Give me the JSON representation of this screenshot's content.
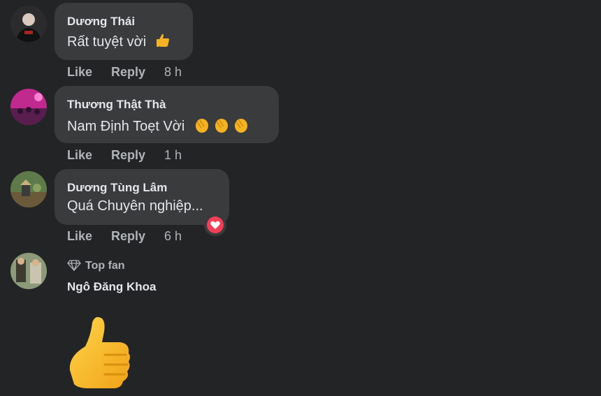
{
  "comments": [
    {
      "author": "Dương Thái",
      "text": "Rất tuyệt vời",
      "emoji": "thumbs-up",
      "like": "Like",
      "reply": "Reply",
      "time": "8 h"
    },
    {
      "author": "Thương Thật Thà",
      "text": "Nam Định Toẹt Vời",
      "emoji": "clapping-hands",
      "like": "Like",
      "reply": "Reply",
      "time": "1 h"
    },
    {
      "author": "Dương Tùng Lâm",
      "text": "Quá Chuyên nghiệp...",
      "reaction": "love",
      "like": "Like",
      "reply": "Reply",
      "time": "6 h"
    },
    {
      "badge": "Top fan",
      "author": "Ngô Đăng Khoa",
      "sticker": "thumbs-up"
    }
  ],
  "colors": {
    "background": "#232425",
    "bubble": "#3a3b3c",
    "text": "#e4e6eb",
    "muted": "#b0b3b8",
    "love": "#f33e58"
  }
}
